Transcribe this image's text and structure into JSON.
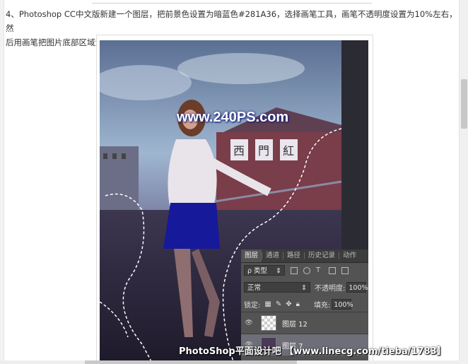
{
  "article": {
    "paragraph_line1": "4、Photoshop CC中文版新建一个图层，把前景色设置为暗蓝色#281A36，选择画笔工具，画笔不透明度设置为10%左右，然",
    "paragraph_line2": "后用画笔把图片底部区域涂暗一点，如下图。"
  },
  "image": {
    "site_watermark": "www.240PS.com",
    "bottom_watermark": "PhotoShop平面设计吧 【www.linecg.com/tieba/1783】",
    "sign_chars": [
      "西",
      "門",
      "紅"
    ]
  },
  "ps_panel": {
    "tabs": [
      "图层",
      "通道",
      "路径",
      "历史记录",
      "动作"
    ],
    "filter_kind": "ρ 类型",
    "blend_mode": "正常",
    "opacity_label": "不透明度:",
    "opacity_value": "100%",
    "lock_label": "锁定:",
    "fill_label": "填充:",
    "fill_value": "100%",
    "layers": [
      {
        "name": "图层 12"
      },
      {
        "name": "图层 7"
      }
    ]
  },
  "colors": {
    "foreground": "#281A36",
    "panel_bg": "#535353"
  }
}
